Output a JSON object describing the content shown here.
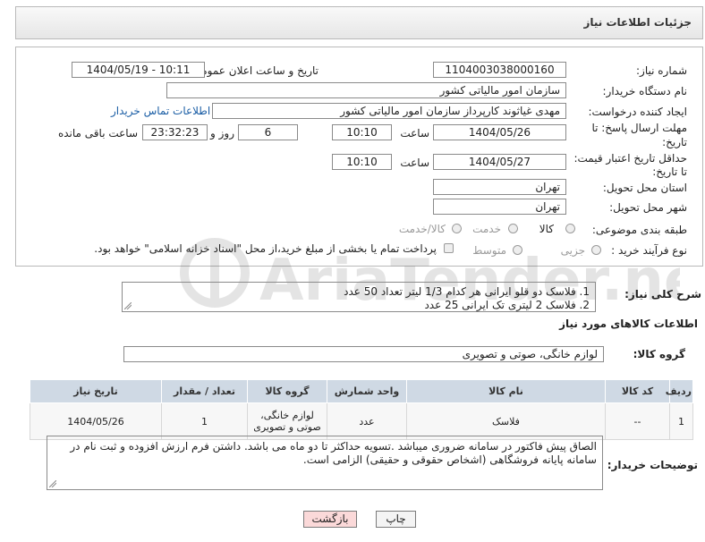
{
  "header": {
    "title": "جزئیات اطلاعات نیاز"
  },
  "form": {
    "need_number_label": "شماره نیاز:",
    "need_number": "1104003038000160",
    "announce_label": "تاریخ و ساعت اعلان عمومی:",
    "announce_value": "1404/05/19 - 10:11",
    "buyer_org_label": "نام دستگاه خریدار:",
    "buyer_org": "سازمان امور مالیاتی کشور",
    "creator_label": "ایجاد کننده درخواست:",
    "creator": "مهدی غیاثوند کارپرداز سازمان امور مالیاتی کشور",
    "contact_link": "اطلاعات تماس خریدار",
    "deadline_label_1": "مهلت ارسال پاسخ: تا",
    "deadline_label_2": "تاریخ:",
    "deadline_date": "1404/05/26",
    "time_label": "ساعت",
    "deadline_time": "10:10",
    "days_value": "6",
    "days_label": "روز و",
    "remaining_value": "23:32:23",
    "remaining_label": "ساعت باقی مانده",
    "validity_label_1": "حداقل تاریخ اعتبار قیمت:",
    "validity_label_2": "تا تاریخ:",
    "validity_date": "1404/05/27",
    "validity_time": "10:10",
    "province_label": "استان محل تحویل:",
    "province": "تهران",
    "city_label": "شهر محل تحویل:",
    "city": "تهران",
    "category_label": "طبقه بندی موضوعی:",
    "category_options": [
      "کالا",
      "خدمت",
      "کالا/خدمت"
    ],
    "process_label": "نوع فرآیند خرید :",
    "process_options": [
      "جزیی",
      "متوسط"
    ],
    "payment_note": "پرداخت تمام یا بخشی از مبلغ خرید،از محل \"اسناد خزانه اسلامی\" خواهد بود."
  },
  "summary": {
    "label": "شرح کلی نیاز:",
    "lines": [
      "1. فلاسک دو قلو ایرانی هر کدام 1/3 لیتر تعداد 50 عدد",
      "2. فلاسک 2 لیتری تک ایرانی 25 عدد"
    ]
  },
  "goods": {
    "section_title": "اطلاعات کالاهای مورد نیاز",
    "group_label": "گروه کالا:",
    "group_value": "لوازم خانگی، صوتی و تصویری",
    "columns": [
      "ردیف",
      "کد کالا",
      "نام کالا",
      "واحد شمارش",
      "گروه کالا",
      "تعداد / مقدار",
      "تاریخ نیاز"
    ],
    "rows": [
      {
        "row": "1",
        "code": "--",
        "name": "فلاسک",
        "unit": "عدد",
        "group_line1": "لوازم خانگی،",
        "group_line2": "صوتی و تصویری",
        "qty": "1",
        "date": "1404/05/26"
      }
    ]
  },
  "buyer_notes": {
    "label": "توضیحات خریدار:",
    "line1": "الصاق پیش فاکتور در سامانه ضروری میباشد .تسویه حداکثر تا دو ماه می باشد.  داشتن فرم ارزش افزوده و ثبت نام در",
    "line2": "سامانه پایانه فروشگاهی (اشخاص حقوقی و حقیقی) الزامی است."
  },
  "buttons": {
    "print": "چاپ",
    "back": "بازگشت"
  },
  "watermark": {
    "text": "AriaTender.neT"
  },
  "colors": {
    "table_header": "#cfd9e4",
    "back_button": "#fbd9d9",
    "link": "#1b5ea5"
  }
}
